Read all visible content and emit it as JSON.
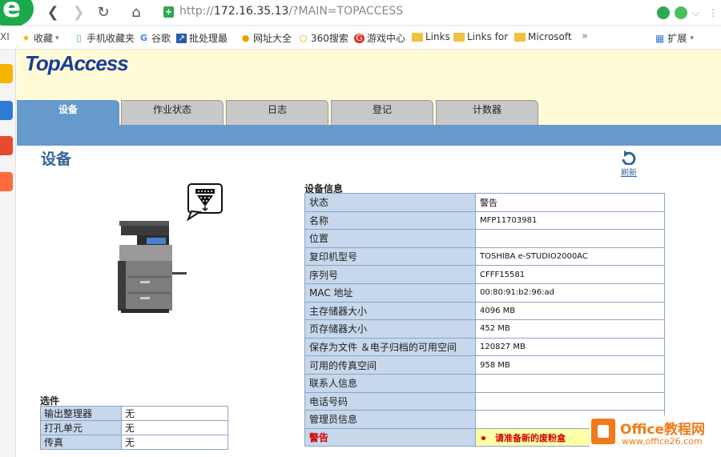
{
  "browser": {
    "url_scheme": "http://",
    "url_host": "172.16.35.13",
    "url_path": "/?MAIN=TOPACCESS",
    "bookmarks": [
      {
        "label": "收藏",
        "icon": "star-icon"
      },
      {
        "label": "手机收藏夹",
        "icon": "phone-icon"
      },
      {
        "label": "谷歌",
        "icon": "google-icon"
      },
      {
        "label": "批处理最",
        "icon": "bookmark-icon"
      },
      {
        "label": "网址大全",
        "icon": "globe-icon"
      },
      {
        "label": "360搜索",
        "icon": "search-icon"
      },
      {
        "label": "游戏中心",
        "icon": "game-icon"
      },
      {
        "label": "Links",
        "icon": "folder-icon"
      },
      {
        "label": "Links for",
        "icon": "folder-icon"
      },
      {
        "label": "Microsoft",
        "icon": "folder-icon"
      }
    ],
    "more_label": "»",
    "extensions_label": "扩展"
  },
  "app": {
    "logo": "TopAccess",
    "tabs": [
      {
        "label": "设备",
        "active": true
      },
      {
        "label": "作业状态",
        "active": false
      },
      {
        "label": "日志",
        "active": false
      },
      {
        "label": "登记",
        "active": false
      },
      {
        "label": "计数器",
        "active": false
      }
    ],
    "section_title": "设备",
    "refresh_label": "刷新"
  },
  "device_info": {
    "title": "设备信息",
    "rows": [
      {
        "key": "状态",
        "value": "警告"
      },
      {
        "key": "名称",
        "value": "MFP11703981"
      },
      {
        "key": "位置",
        "value": ""
      },
      {
        "key": "复印机型号",
        "value": "TOSHIBA e-STUDIO2000AC"
      },
      {
        "key": "序列号",
        "value": "CFFF15581"
      },
      {
        "key": "MAC 地址",
        "value": "00:80:91:b2:96:ad"
      },
      {
        "key": "主存储器大小",
        "value": "4096 MB"
      },
      {
        "key": "页存储器大小",
        "value": "452 MB"
      },
      {
        "key": "保存为文件 ＆电子归档的可用空间",
        "value": "120827 MB"
      },
      {
        "key": "可用的传真空间",
        "value": "958 MB"
      },
      {
        "key": "联系人信息",
        "value": ""
      },
      {
        "key": "电话号码",
        "value": ""
      },
      {
        "key": "管理员信息",
        "value": ""
      }
    ],
    "warning": {
      "key": "警告",
      "value": "请准备新的废粉盒"
    }
  },
  "options": {
    "title": "选件",
    "rows": [
      {
        "key": "输出整理器",
        "value": "无"
      },
      {
        "key": "打孔单元",
        "value": "无"
      },
      {
        "key": "传真",
        "value": "无"
      }
    ]
  },
  "watermark": {
    "brand": "Office教程网",
    "site": "www.office26.com"
  },
  "colors": {
    "tab_active": "#6699cc",
    "tab_inactive": "#c8c8c8",
    "banner": "#fffbd7",
    "key_cell": "#c7d7ec",
    "warning_text": "#d40000",
    "warning_cell": "#ffffa6",
    "logo": "#1b3d9a"
  }
}
